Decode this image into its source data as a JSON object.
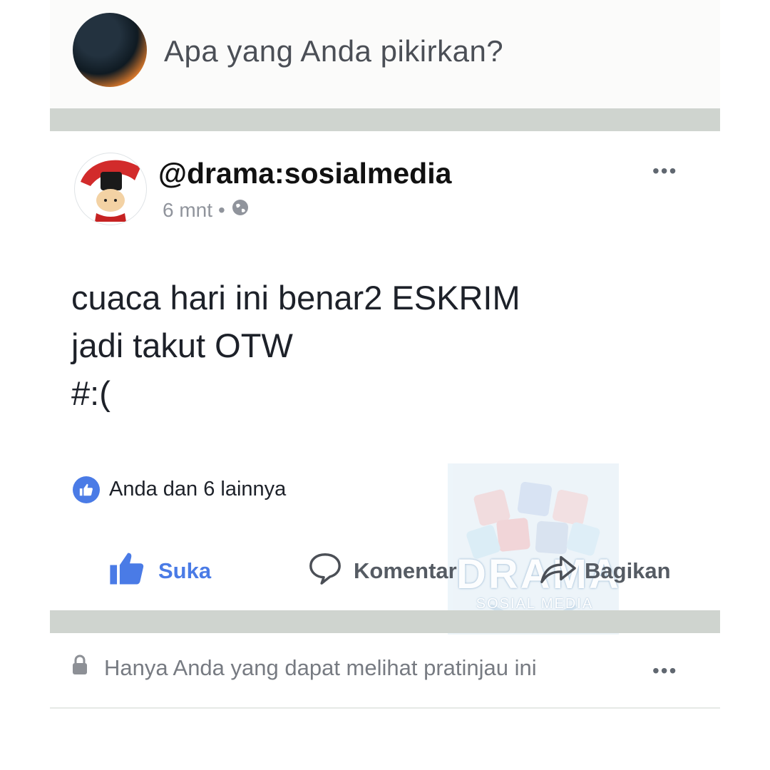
{
  "composer": {
    "prompt": "Apa yang Anda pikirkan?"
  },
  "post": {
    "author": "@drama:sosialmedia",
    "time": "6 mnt",
    "separator": "•",
    "privacy_icon": "globe-icon",
    "body_lines": [
      "cuaca hari ini benar2 ESKRIM",
      "jadi takut OTW",
      "#:("
    ],
    "reactions_text": "Anda dan 6 lainnya",
    "actions": {
      "like": "Suka",
      "comment": "Komentar",
      "share": "Bagikan"
    }
  },
  "footer": {
    "privacy_note": "Hanya Anda yang dapat melihat pratinjau ini"
  },
  "watermark": {
    "title": "DRAMA",
    "subtitle": "SOSIAL MEDIA"
  },
  "colors": {
    "facebook_blue": "#4a7be6",
    "divider": "#cfd4cf",
    "muted_text": "#90949c"
  }
}
